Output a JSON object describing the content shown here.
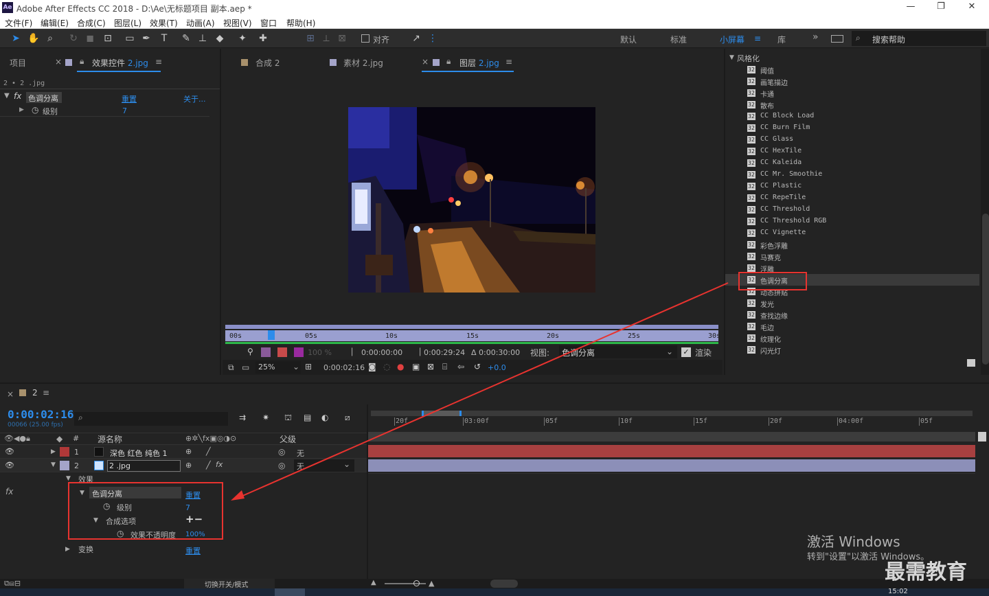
{
  "window": {
    "title": "Adobe After Effects CC 2018 - D:\\Ae\\无标题项目 副本.aep *",
    "logo": "Ae",
    "min": "—",
    "max": "❐",
    "close": "✕"
  },
  "menu": [
    "文件(F)",
    "编辑(E)",
    "合成(C)",
    "图层(L)",
    "效果(T)",
    "动画(A)",
    "视图(V)",
    "窗口",
    "帮助(H)"
  ],
  "toolbar": {
    "align_label": "对齐",
    "workspaces": [
      "默认",
      "标准",
      "小屏幕",
      "库"
    ],
    "search_placeholder": "搜索帮助",
    "more": "»"
  },
  "left_panel": {
    "tab_project": "项目",
    "tab_effects_prefix": "效果控件",
    "tab_effects_layer": "2.jpg",
    "breadcrumb": "2 • 2 .jpg",
    "effect_name": "色调分离",
    "reset": "重置",
    "about": "关于...",
    "param_label": "级别",
    "param_value": "7"
  },
  "viewer": {
    "tabs": [
      {
        "label": "合成 2",
        "color": "#a8916c"
      },
      {
        "label": "素材 2.jpg",
        "color": "#a4a4c9"
      },
      {
        "label_prefix": "图层",
        "label_layer": "2.jpg",
        "color": "#a4a4c9"
      }
    ],
    "ruler_ticks": [
      "00s",
      "05s",
      "10s",
      "15s",
      "20s",
      "25s",
      "30s"
    ],
    "time_in": "0:00:00:00",
    "time_out": "0:00:29:24",
    "duration": "Δ 0:00:30:00",
    "view_label": "视图:",
    "view_value": "色调分离",
    "render_label": "渲染",
    "zoom": "25%",
    "current_time": "0:00:02:16",
    "exposure": "+0.0",
    "opacity_value": "100 %"
  },
  "effects_panel": {
    "category": "风格化",
    "items": [
      "阈值",
      "画笔描边",
      "卡通",
      "散布",
      "CC Block Load",
      "CC Burn Film",
      "CC Glass",
      "CC HexTile",
      "CC Kaleida",
      "CC Mr. Smoothie",
      "CC Plastic",
      "CC RepeTile",
      "CC Threshold",
      "CC Threshold RGB",
      "CC Vignette",
      "彩色浮雕",
      "马赛克",
      "浮雕",
      "色调分离",
      "动态拼贴",
      "发光",
      "查找边缘",
      "毛边",
      "纹理化",
      "闪光灯"
    ],
    "selected_index": 18
  },
  "timeline": {
    "comp_name": "2",
    "current_time": "0:00:02:16",
    "fps_info": "00066 (25.00 fps)",
    "header": {
      "num": "#",
      "source": "源名称",
      "parent": "父级"
    },
    "layers": [
      {
        "num": "1",
        "name": "深色 红色 纯色 1",
        "label_color": "#b03838",
        "parent": "无"
      },
      {
        "num": "2",
        "name": "2 .jpg",
        "label_color": "#a4a4c9",
        "parent": "无"
      }
    ],
    "props": {
      "effects_group": "效果",
      "effect_name": "色调分离",
      "reset": "重置",
      "level_label": "级别",
      "level_value": "7",
      "comp_options": "合成选项",
      "plus_minus": "+−",
      "opacity_label": "效果不透明度",
      "opacity_value": "100%",
      "transform": "变换",
      "transform_reset": "重置"
    },
    "ruler_ticks": [
      "20f",
      "03:00f",
      "05f",
      "10f",
      "15f",
      "20f",
      "04:00f",
      "05f"
    ],
    "footer_toggle": "切换开关/模式"
  },
  "watermark": {
    "activate": "激活 Windows",
    "activate_sub": "转到\"设置\"以激活 Windows。",
    "brand": "最需教育",
    "clock": "15:02"
  }
}
